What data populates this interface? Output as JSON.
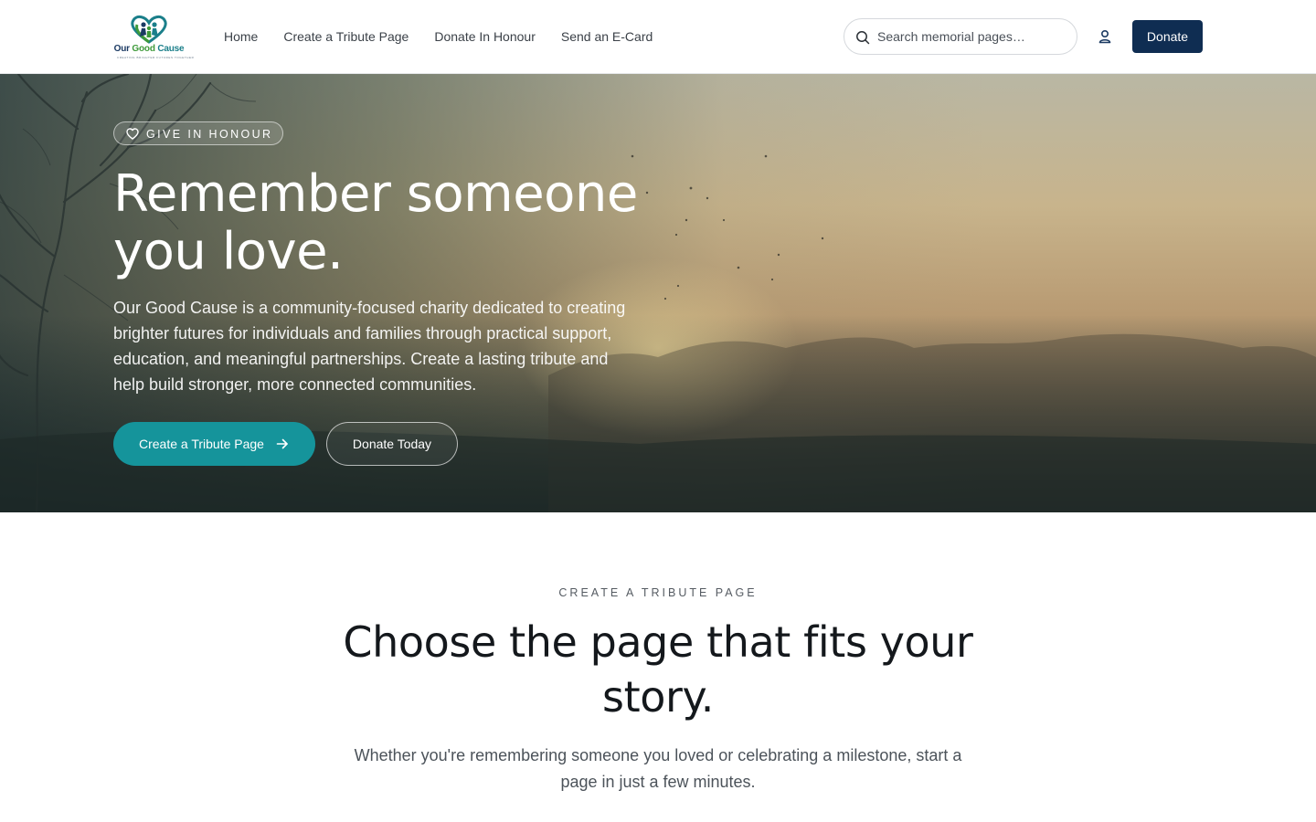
{
  "header": {
    "logo": {
      "word1": "Our",
      "word2": "Good",
      "word3": "Cause",
      "tagline": "CREATING BRIGHTER FUTURES TOGETHER"
    },
    "nav": [
      {
        "label": "Home"
      },
      {
        "label": "Create a Tribute Page"
      },
      {
        "label": "Donate In Honour"
      },
      {
        "label": "Send an E-Card"
      }
    ],
    "search": {
      "placeholder": "Search memorial pages…",
      "icon": "search-icon"
    },
    "account_icon": "user-icon",
    "donate_label": "Donate"
  },
  "hero": {
    "badge": {
      "icon": "heart-icon",
      "label": "GIVE IN HONOUR"
    },
    "title": "Remember someone you love.",
    "text": "Our Good Cause is a community-focused charity dedicated to creating brighter futures for individuals and families through practical support, education, and meaningful partnerships. Create a lasting tribute and help build stronger, more connected communities.",
    "primary_button": {
      "label": "Create a Tribute Page",
      "icon": "arrow-right-icon"
    },
    "secondary_button": {
      "label": "Donate Today"
    }
  },
  "section": {
    "eyebrow": "CREATE A TRIBUTE PAGE",
    "title": "Choose the page that fits your story.",
    "text": "Whether you're remembering someone you loved or celebrating a milestone, start a page in just a few minutes."
  },
  "colors": {
    "navy": "#0f2d52",
    "teal": "#15949b",
    "green": "#3e9a3a"
  }
}
